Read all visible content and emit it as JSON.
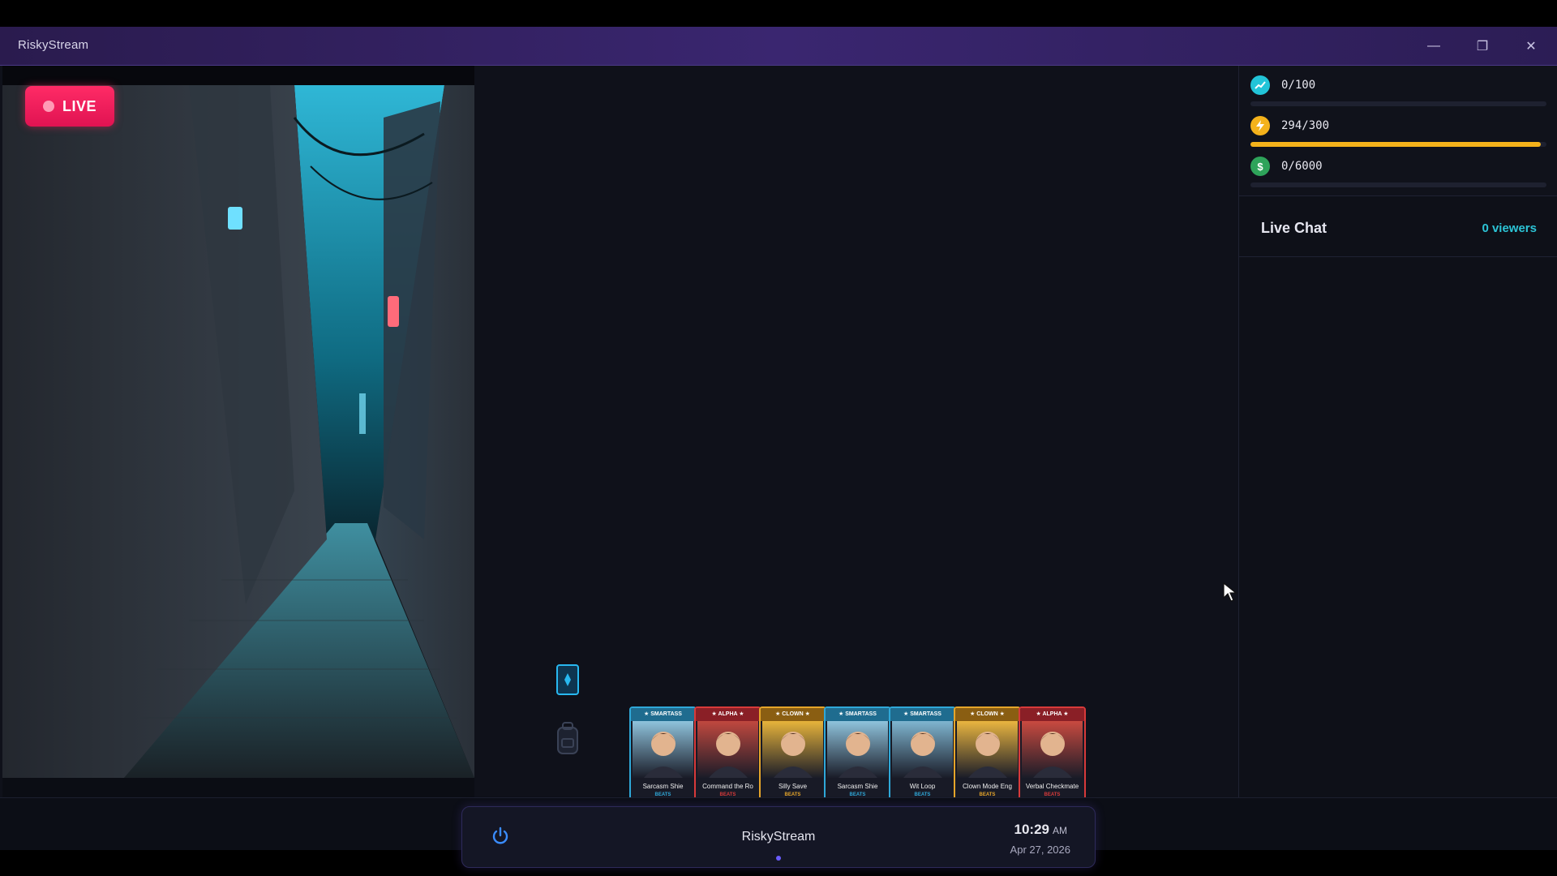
{
  "window": {
    "title": "RiskyStream",
    "controls": {
      "minimize": "—",
      "maximize": "❐",
      "close": "✕"
    }
  },
  "video": {
    "live_label": "LIVE"
  },
  "stats": [
    {
      "icon": "trending-up-icon",
      "text": "0/100",
      "color": "#22c4d8",
      "fraction": 0.0
    },
    {
      "icon": "lightning-icon",
      "text": "294/300",
      "color": "#f4b21b",
      "fraction": 0.98
    },
    {
      "icon": "dollar-icon",
      "text": "0/6000",
      "color": "#2ea35a",
      "fraction": 0.0
    }
  ],
  "chat": {
    "title": "Live Chat",
    "viewers": "0 viewers"
  },
  "cards": [
    {
      "tag": "★ SMARTASS",
      "name": "Sarcasm Shie",
      "beats": "BEATS",
      "frame": "#2fa8d8",
      "head": "#1f6c8f",
      "art": "#8fc3dc",
      "coin": "#8a3cc8"
    },
    {
      "tag": "★ ALPHA ★",
      "name": "Command the Ro",
      "beats": "BEATS",
      "frame": "#d83a3a",
      "head": "#8a1f26",
      "art": "#c0483f",
      "coin": "#d49a21"
    },
    {
      "tag": "★ CLOWN ★",
      "name": "Silly Save",
      "beats": "BEATS",
      "frame": "#e5a52a",
      "head": "#8a5e12",
      "art": "#e6b33b",
      "coin": "#d9541f"
    },
    {
      "tag": "★ SMARTASS",
      "name": "Sarcasm Shie",
      "beats": "BEATS",
      "frame": "#2fa8d8",
      "head": "#1f6c8f",
      "art": "#8fc3dc",
      "coin": "#8a3cc8"
    },
    {
      "tag": "★ SMARTASS",
      "name": "Wit Loop",
      "beats": "BEATS",
      "frame": "#2fa8d8",
      "head": "#1f6c8f",
      "art": "#7fb5d0",
      "coin": "#d9541f"
    },
    {
      "tag": "★ CLOWN ★",
      "name": "Clown Mode Eng",
      "beats": "BEATS",
      "frame": "#e5a52a",
      "head": "#8a5e12",
      "art": "#e9b540",
      "coin": "#d23a3a"
    },
    {
      "tag": "★ ALPHA ★",
      "name": "Verbal Checkmate",
      "beats": "BEATS",
      "frame": "#d83a3a",
      "head": "#8a1f26",
      "art": "#c94a40",
      "coin": "#8a3cc8"
    }
  ],
  "dock": {
    "name": "RiskyStream",
    "time": "10:29",
    "ampm": "AM",
    "date": "Apr 27, 2026"
  }
}
